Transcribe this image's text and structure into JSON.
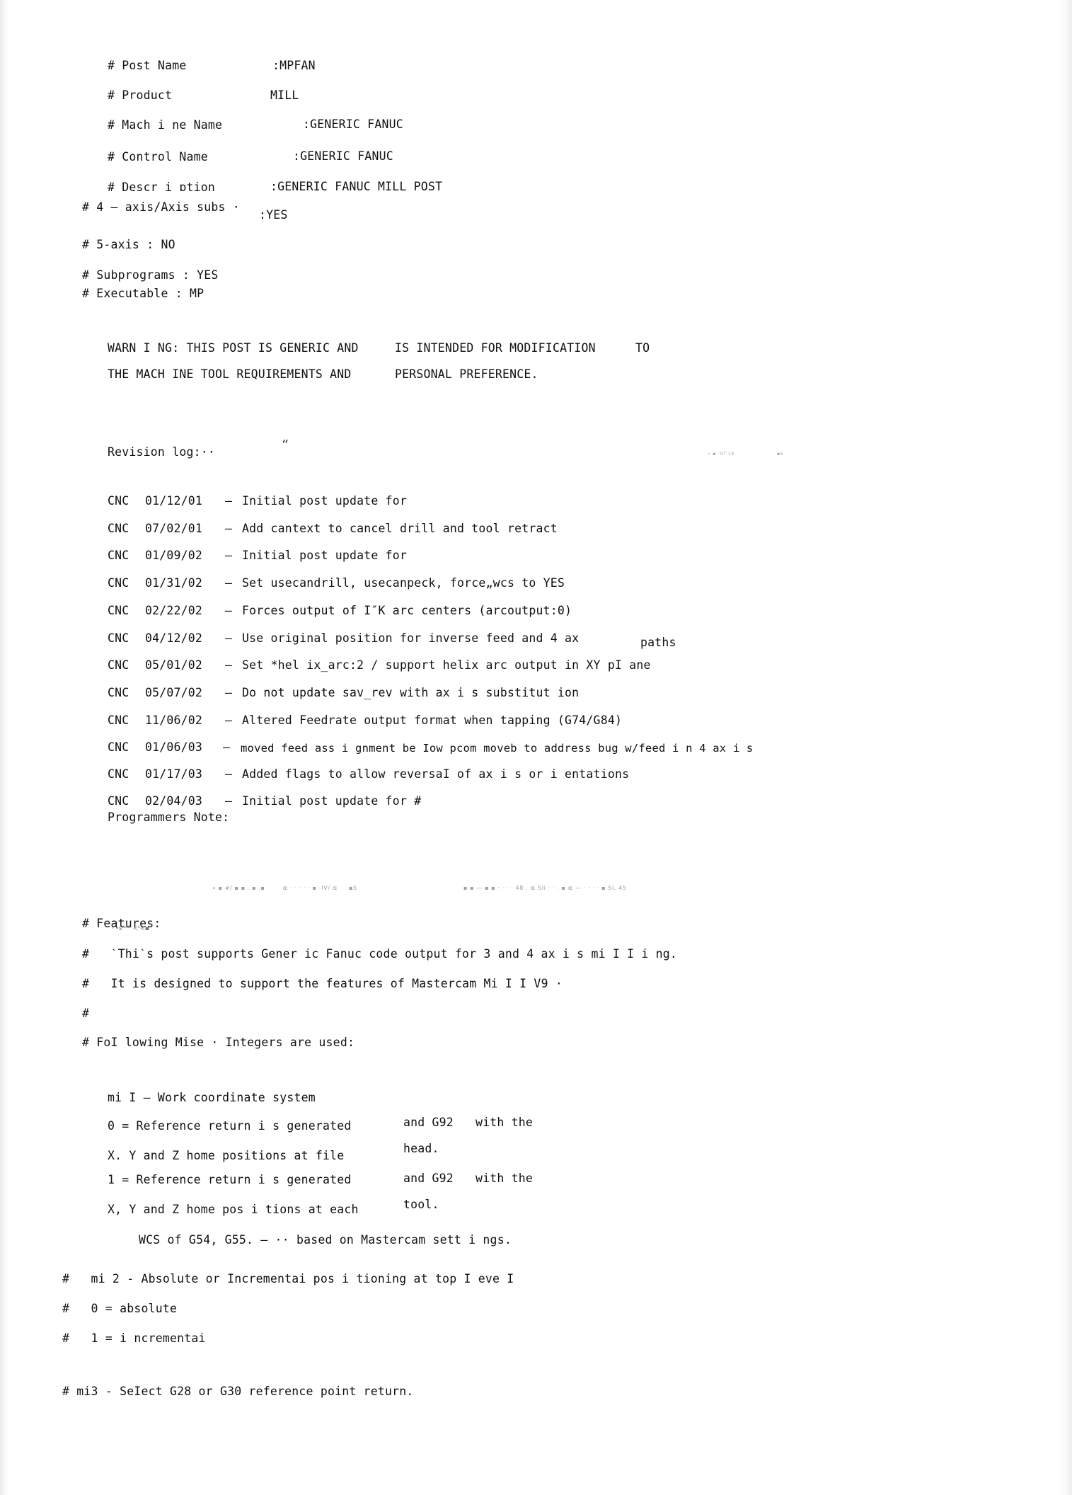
{
  "document": {
    "type": "scanned-text-page",
    "title": "MPFAN Generic Fanuc Mill Post Processor Header"
  },
  "header_fields": [
    {
      "label": "# Post Name",
      "value": ":MPFAN"
    },
    {
      "label": "# Product",
      "value": "MILL"
    },
    {
      "label": "# Mach i ne Name",
      "value": ":GENERIC FANUC"
    },
    {
      "label": "# Control Name",
      "value": ":GENERIC FANUC"
    },
    {
      "label": "# Descr i ɒtion",
      "value": ":GENERIC FANUC MILL POST"
    },
    {
      "label": "# 4 — axis/Axis subs ·",
      "value": ":YES"
    }
  ],
  "flags": [
    "# 5-axis : NO",
    "# Subprograms : YES",
    "# Executable : MP"
  ],
  "warning": {
    "col1_line1": "WARN I NG: THIS POST IS GENERIC AND",
    "col2_line1": "IS INTENDED FOR MODIFICATION",
    "col3_line1": "TO",
    "col1_line2": "THE MACH INE TOOL REQUIREMENTS AND",
    "col2_line2": "PERSONAL PREFERENCE."
  },
  "revision": {
    "heading": "Revision log:··",
    "quote_glyph": "“",
    "noise_right": "« ▪ 'Of 18",
    "noise_right2": "▪5",
    "entries": [
      {
        "tag": "CNC",
        "date": "01/12/01",
        "dash": "—",
        "text": "Initial post update for",
        "trailing": ""
      },
      {
        "tag": "CNC",
        "date": "07/02/01",
        "dash": "—",
        "text": "Add cantext to cancel drill and tool retract",
        "trailing": ""
      },
      {
        "tag": "CNC",
        "date": "01/09/02",
        "dash": "—",
        "text": "Initial post update for",
        "trailing": ""
      },
      {
        "tag": "CNC",
        "date": "01/31/02",
        "dash": "—",
        "text": "Set usecandrill, usecanpeck, force„wcs to YES",
        "trailing": ""
      },
      {
        "tag": "CNC",
        "date": "02/22/02",
        "dash": "—",
        "text": "Forces output of I″K arc centers (arcoutput:0)",
        "trailing": ""
      },
      {
        "tag": "CNC",
        "date": "04/12/02",
        "dash": "—",
        "text": "Use original position for inverse feed and 4 ax",
        "trailing": "paths"
      },
      {
        "tag": "CNC",
        "date": "05/01/02",
        "dash": "—",
        "text": "Set *hel ix_arc:2 / support helix arc output in XY pI ane",
        "trailing": ""
      },
      {
        "tag": "CNC",
        "date": "05/07/02",
        "dash": "—",
        "text": "Do not update sav_rev with ax i s substitut ion",
        "trailing": ""
      },
      {
        "tag": "CNC",
        "date": "11/06/02",
        "dash": "—",
        "text": "Altered Feedrate output format when tapping (G74/G84)",
        "trailing": ""
      },
      {
        "tag": "CNC",
        "date": "01/06/03",
        "dash": "—",
        "text": "moved feed ass i gnment be Iow pcom moveb to address bug w/feed i n 4 ax i s",
        "trailing": ""
      },
      {
        "tag": "CNC",
        "date": "01/17/03",
        "dash": "—",
        "text": "Added flags to allow reversaI of ax i s or i entations",
        "trailing": ""
      },
      {
        "tag": "CNC",
        "date": "02/04/03",
        "dash": "—",
        "text": "Initial post update for #",
        "trailing": ""
      }
    ],
    "programmers_note": "Programmers Note:"
  },
  "noise_band": {
    "left": "« ▪ #/ ▪ ▪ . ▪ .▪        ɶ · · · · · ▪ -IV/ ɶ     ▪5",
    "right": "▪ ▪ — ▪ ▪ · · · · 48 . ɶ 5Ii · · . ▪ ɶ — · · · · ▪ 5I. 45"
  },
  "features": {
    "heading": "# Features:",
    "smudge": "·‘•sᴻˢᵈᵛ <ʰ<▪",
    "lines": [
      "#   ˋThiˋs post supports Gener ic Fanuc code output for 3 and 4 ax i s mi I I i ng.",
      "#   It is designed to support the features of Mastercam Mi I I V9 ·",
      "#"
    ],
    "misc_heading": "# FoI lowing Mise · Integers are used:"
  },
  "mi1": {
    "title": "mi I — Work coordinate system",
    "rows": [
      {
        "left": "0 = Reference return i s generated",
        "mid": "and G92",
        "right": "with the"
      },
      {
        "left": "X. Y and Z home positions at file",
        "mid": "head.",
        "right": ""
      },
      {
        "left": "1 = Reference return i s generated",
        "mid": "and G92",
        "right": "with the"
      },
      {
        "left": "X, Y and Z home pos i tions at each",
        "mid": "tool.",
        "right": ""
      }
    ],
    "wcs_line": "WCS of G54, G55. — ·· based on Mastercam sett i ngs."
  },
  "mi2": {
    "lines": [
      "#   mi 2 - Absolute or Incrementai pos i tioning at top I eve I",
      "#   0 = absolute",
      "#   1 = i ncrementai"
    ]
  },
  "mi3": {
    "line": "# mi3 - SeIect G28 or G30 reference point return."
  }
}
